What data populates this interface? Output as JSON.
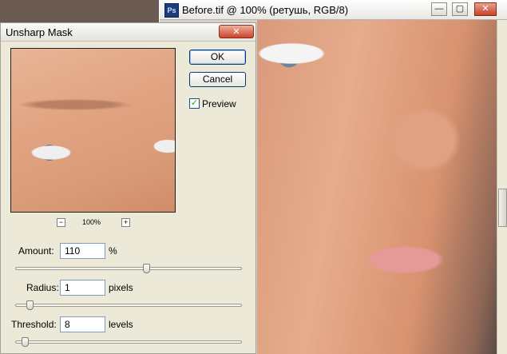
{
  "document": {
    "title": "Before.tif @ 100% (ретушь, RGB/8)",
    "app_icon": "ps-icon",
    "window_buttons": {
      "minimize": "—",
      "restore": "▢",
      "close": "✕"
    }
  },
  "dialog": {
    "title": "Unsharp Mask",
    "close_glyph": "✕",
    "ok_label": "OK",
    "cancel_label": "Cancel",
    "preview_label": "Preview",
    "preview_checked": true,
    "zoom": {
      "minus": "−",
      "plus": "+",
      "level": "100%"
    },
    "params": [
      {
        "label": "Amount:",
        "value": "110",
        "unit": "%",
        "slider_fraction": 0.58
      },
      {
        "label": "Radius:",
        "value": "1",
        "unit": "pixels",
        "slider_fraction": 0.05
      },
      {
        "label": "Threshold:",
        "value": "8",
        "unit": "levels",
        "slider_fraction": 0.03
      }
    ]
  },
  "scrollbar": {
    "thumb_fraction": 0.57
  }
}
